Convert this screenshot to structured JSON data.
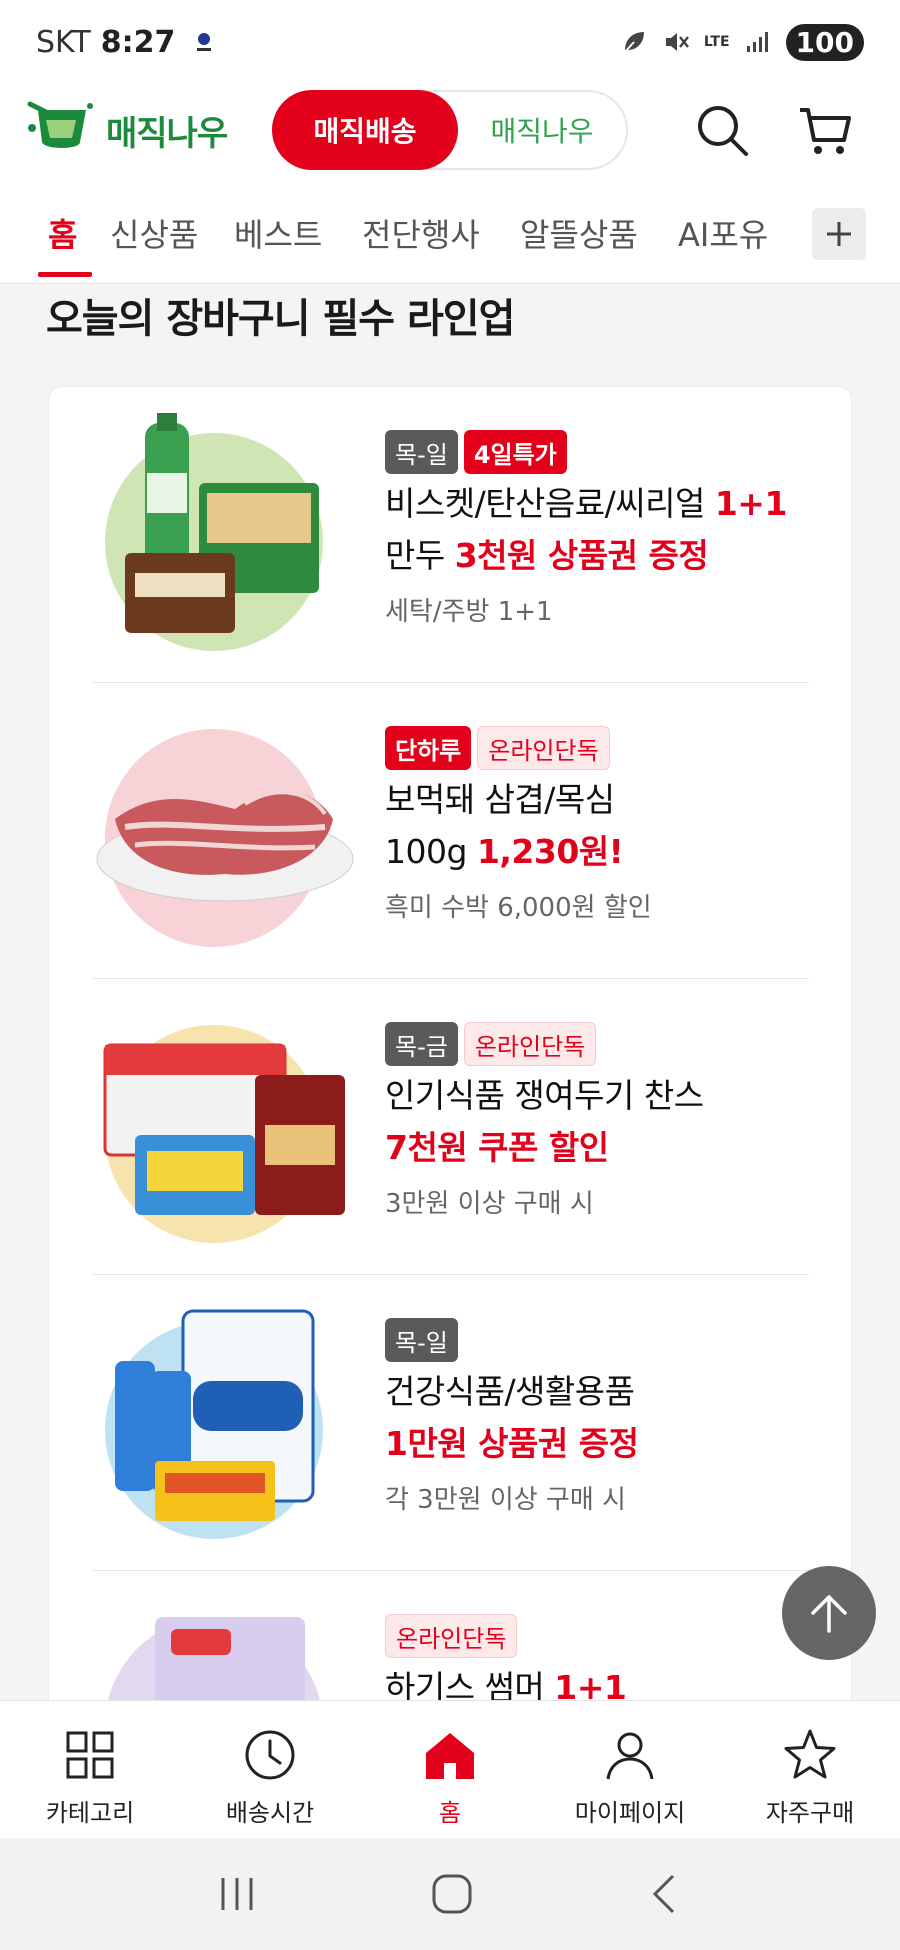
{
  "status_bar": {
    "carrier": "SKT",
    "time": "8:27",
    "network": "LTE",
    "battery": "100"
  },
  "header": {
    "logo_text": "매직나우",
    "toggle_active": "매직배송",
    "toggle_inactive": "매직나우",
    "brand_color": "#e3001b"
  },
  "tabs": [
    {
      "label": "홈",
      "active": true
    },
    {
      "label": "신상품"
    },
    {
      "label": "베스트"
    },
    {
      "label": "전단행사"
    },
    {
      "label": "알뜰상품"
    },
    {
      "label": "AI포유"
    }
  ],
  "section_title": "오늘의 장바구니 필수 라인업",
  "items": [
    {
      "badges": [
        {
          "text": "목-일",
          "style": "gray"
        },
        {
          "text": "4일특가",
          "style": "red"
        }
      ],
      "line1": "비스켓/탄산음료/씨리얼 ",
      "line1_hl": "1+1",
      "line2": "만두 ",
      "line2_hl": "3천원 상품권 증정",
      "sub": "세탁/주방 1+1"
    },
    {
      "badges": [
        {
          "text": "단하루",
          "style": "red"
        },
        {
          "text": "온라인단독",
          "style": "pink"
        }
      ],
      "line1": "보먹돼 삼겹/목심",
      "line1_hl": "",
      "line2": "100g ",
      "line2_hl": "1,230원!",
      "sub": "흑미 수박 6,000원 할인"
    },
    {
      "badges": [
        {
          "text": "목-금",
          "style": "gray"
        },
        {
          "text": "온라인단독",
          "style": "pink"
        }
      ],
      "line1": "인기식품 쟁여두기 찬스",
      "line1_hl": "",
      "line2": "",
      "line2_hl": "7천원 쿠폰 할인",
      "sub": "3만원 이상 구매 시"
    },
    {
      "badges": [
        {
          "text": "목-일",
          "style": "gray"
        }
      ],
      "line1": "건강식품/생활용품",
      "line1_hl": "",
      "line2": "",
      "line2_hl": "1만원 상품권 증정",
      "sub": "각 3만원 이상 구매 시"
    },
    {
      "badges": [
        {
          "text": "온라인단독",
          "style": "pink"
        }
      ],
      "line1": "하기스 썸머 ",
      "line1_hl": "1+1",
      "line2": "",
      "line2_hl": "",
      "sub": ""
    }
  ],
  "bottom_nav": [
    {
      "label": "카테고리"
    },
    {
      "label": "배송시간"
    },
    {
      "label": "홈",
      "active": true
    },
    {
      "label": "마이페이지"
    },
    {
      "label": "자주구매"
    }
  ]
}
